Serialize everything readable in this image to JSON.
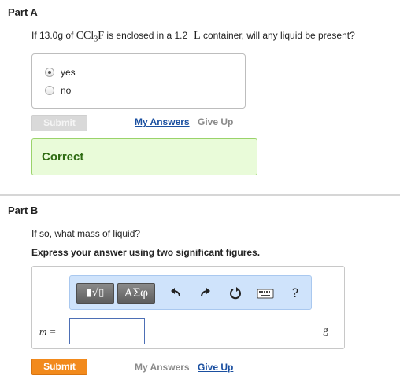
{
  "partA": {
    "title": "Part A",
    "question": {
      "pre": "If 13.0g of ",
      "formula_main": "CCl",
      "formula_sub": "3",
      "formula_tail": "F",
      "mid": " is enclosed in a 1.2",
      "unit": "−L",
      "post": " container, will any liquid be present?"
    },
    "options": [
      {
        "label": "yes",
        "selected": true
      },
      {
        "label": "no",
        "selected": false
      }
    ],
    "submit_label": "Submit",
    "my_answers_label": "My Answers",
    "give_up_label": "Give Up",
    "feedback": "Correct"
  },
  "partB": {
    "title": "Part B",
    "question": "If so, what mass of liquid?",
    "instruction": "Express your answer using two significant figures.",
    "toolbar": {
      "template_glyph": "▮√▯",
      "greek_glyph": "ΑΣφ",
      "help_glyph": "?"
    },
    "variable_label": "m =",
    "answer_value": "",
    "unit": "g",
    "submit_label": "Submit",
    "my_answers_label": "My Answers",
    "give_up_label": "Give Up"
  },
  "colors": {
    "accent_orange": "#f28a1c",
    "correct_green": "#2e6b12",
    "link_blue": "#1a4fa0",
    "toolbar_blue": "#cfe3fb"
  },
  "icons": [
    "undo-icon",
    "redo-icon",
    "reset-icon",
    "keyboard-icon",
    "help-icon"
  ]
}
